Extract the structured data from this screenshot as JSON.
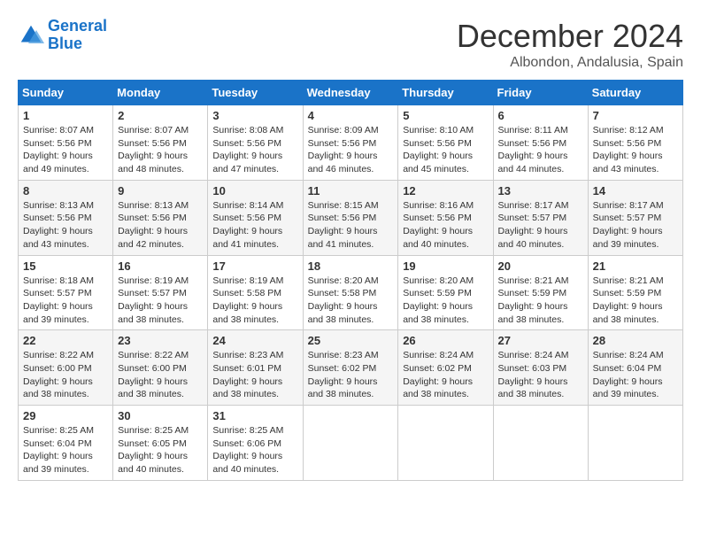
{
  "logo": {
    "line1": "General",
    "line2": "Blue"
  },
  "title": "December 2024",
  "subtitle": "Albondon, Andalusia, Spain",
  "weekdays": [
    "Sunday",
    "Monday",
    "Tuesday",
    "Wednesday",
    "Thursday",
    "Friday",
    "Saturday"
  ],
  "weeks": [
    [
      {
        "day": "1",
        "sunrise": "8:07 AM",
        "sunset": "5:56 PM",
        "daylight": "9 hours and 49 minutes."
      },
      {
        "day": "2",
        "sunrise": "8:07 AM",
        "sunset": "5:56 PM",
        "daylight": "9 hours and 48 minutes."
      },
      {
        "day": "3",
        "sunrise": "8:08 AM",
        "sunset": "5:56 PM",
        "daylight": "9 hours and 47 minutes."
      },
      {
        "day": "4",
        "sunrise": "8:09 AM",
        "sunset": "5:56 PM",
        "daylight": "9 hours and 46 minutes."
      },
      {
        "day": "5",
        "sunrise": "8:10 AM",
        "sunset": "5:56 PM",
        "daylight": "9 hours and 45 minutes."
      },
      {
        "day": "6",
        "sunrise": "8:11 AM",
        "sunset": "5:56 PM",
        "daylight": "9 hours and 44 minutes."
      },
      {
        "day": "7",
        "sunrise": "8:12 AM",
        "sunset": "5:56 PM",
        "daylight": "9 hours and 43 minutes."
      }
    ],
    [
      {
        "day": "8",
        "sunrise": "8:13 AM",
        "sunset": "5:56 PM",
        "daylight": "9 hours and 43 minutes."
      },
      {
        "day": "9",
        "sunrise": "8:13 AM",
        "sunset": "5:56 PM",
        "daylight": "9 hours and 42 minutes."
      },
      {
        "day": "10",
        "sunrise": "8:14 AM",
        "sunset": "5:56 PM",
        "daylight": "9 hours and 41 minutes."
      },
      {
        "day": "11",
        "sunrise": "8:15 AM",
        "sunset": "5:56 PM",
        "daylight": "9 hours and 41 minutes."
      },
      {
        "day": "12",
        "sunrise": "8:16 AM",
        "sunset": "5:56 PM",
        "daylight": "9 hours and 40 minutes."
      },
      {
        "day": "13",
        "sunrise": "8:17 AM",
        "sunset": "5:57 PM",
        "daylight": "9 hours and 40 minutes."
      },
      {
        "day": "14",
        "sunrise": "8:17 AM",
        "sunset": "5:57 PM",
        "daylight": "9 hours and 39 minutes."
      }
    ],
    [
      {
        "day": "15",
        "sunrise": "8:18 AM",
        "sunset": "5:57 PM",
        "daylight": "9 hours and 39 minutes."
      },
      {
        "day": "16",
        "sunrise": "8:19 AM",
        "sunset": "5:57 PM",
        "daylight": "9 hours and 38 minutes."
      },
      {
        "day": "17",
        "sunrise": "8:19 AM",
        "sunset": "5:58 PM",
        "daylight": "9 hours and 38 minutes."
      },
      {
        "day": "18",
        "sunrise": "8:20 AM",
        "sunset": "5:58 PM",
        "daylight": "9 hours and 38 minutes."
      },
      {
        "day": "19",
        "sunrise": "8:20 AM",
        "sunset": "5:59 PM",
        "daylight": "9 hours and 38 minutes."
      },
      {
        "day": "20",
        "sunrise": "8:21 AM",
        "sunset": "5:59 PM",
        "daylight": "9 hours and 38 minutes."
      },
      {
        "day": "21",
        "sunrise": "8:21 AM",
        "sunset": "5:59 PM",
        "daylight": "9 hours and 38 minutes."
      }
    ],
    [
      {
        "day": "22",
        "sunrise": "8:22 AM",
        "sunset": "6:00 PM",
        "daylight": "9 hours and 38 minutes."
      },
      {
        "day": "23",
        "sunrise": "8:22 AM",
        "sunset": "6:00 PM",
        "daylight": "9 hours and 38 minutes."
      },
      {
        "day": "24",
        "sunrise": "8:23 AM",
        "sunset": "6:01 PM",
        "daylight": "9 hours and 38 minutes."
      },
      {
        "day": "25",
        "sunrise": "8:23 AM",
        "sunset": "6:02 PM",
        "daylight": "9 hours and 38 minutes."
      },
      {
        "day": "26",
        "sunrise": "8:24 AM",
        "sunset": "6:02 PM",
        "daylight": "9 hours and 38 minutes."
      },
      {
        "day": "27",
        "sunrise": "8:24 AM",
        "sunset": "6:03 PM",
        "daylight": "9 hours and 38 minutes."
      },
      {
        "day": "28",
        "sunrise": "8:24 AM",
        "sunset": "6:04 PM",
        "daylight": "9 hours and 39 minutes."
      }
    ],
    [
      {
        "day": "29",
        "sunrise": "8:25 AM",
        "sunset": "6:04 PM",
        "daylight": "9 hours and 39 minutes."
      },
      {
        "day": "30",
        "sunrise": "8:25 AM",
        "sunset": "6:05 PM",
        "daylight": "9 hours and 40 minutes."
      },
      {
        "day": "31",
        "sunrise": "8:25 AM",
        "sunset": "6:06 PM",
        "daylight": "9 hours and 40 minutes."
      },
      null,
      null,
      null,
      null
    ]
  ]
}
